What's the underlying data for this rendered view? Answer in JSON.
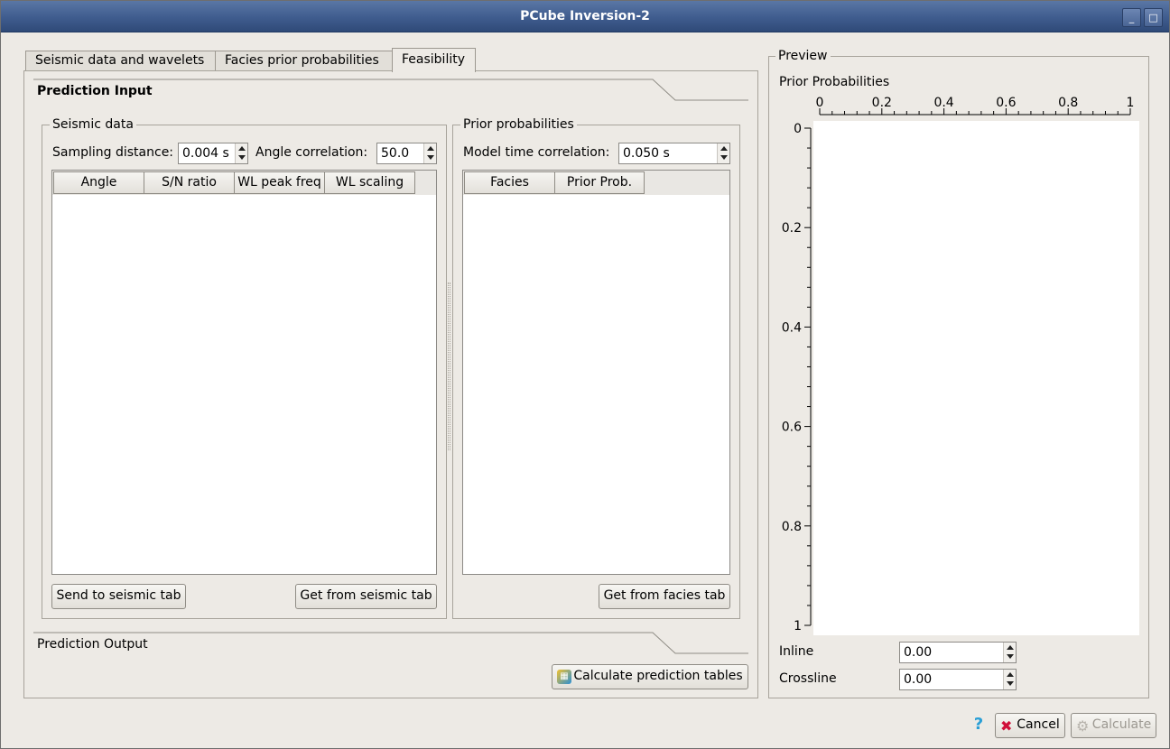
{
  "window": {
    "title": "PCube Inversion-2",
    "minimize_glyph": "_",
    "maximize_glyph": "□"
  },
  "tabs": [
    {
      "label": "Seismic data and wavelets",
      "active": false
    },
    {
      "label": "Facies prior probabilities",
      "active": false
    },
    {
      "label": "Feasibility",
      "active": true
    }
  ],
  "prediction_input": {
    "heading": "Prediction Input",
    "seismic": {
      "title": "Seismic data",
      "sampling_label": "Sampling distance:",
      "sampling_value": "0.004 s",
      "angle_label": "Angle correlation:",
      "angle_value": "50.0",
      "columns": [
        "Angle",
        "S/N ratio",
        "WL peak freq",
        "WL scaling"
      ],
      "send_button": "Send to seismic tab",
      "get_button": "Get from seismic tab"
    },
    "prior": {
      "title": "Prior probabilities",
      "model_time_label": "Model time correlation:",
      "model_time_value": "0.050 s",
      "columns": [
        "Facies",
        "Prior Prob."
      ],
      "get_button": "Get from facies tab"
    }
  },
  "prediction_output": {
    "heading": "Prediction Output",
    "calc_tables_button": "Calculate prediction tables",
    "calc_icon": "calculator-icon"
  },
  "preview": {
    "title": "Preview",
    "chart_title": "Prior Probabilities",
    "inline_label": "Inline",
    "inline_value": "0.00",
    "crossline_label": "Crossline",
    "crossline_value": "0.00"
  },
  "chart_data": {
    "type": "scatter",
    "title": "Prior Probabilities",
    "x_ticks": [
      "0",
      "0.2",
      "0.4",
      "0.6",
      "0.8",
      "1"
    ],
    "y_ticks": [
      "0",
      "0.2",
      "0.4",
      "0.6",
      "0.8",
      "1"
    ],
    "xlim": [
      0,
      1
    ],
    "ylim": [
      0,
      1
    ],
    "x_axis_position": "top",
    "y_inverted": true,
    "series": []
  },
  "footer": {
    "help_icon": "help-icon",
    "help_glyph": "?",
    "cancel_glyph": "✖",
    "calc_glyph": "⚙",
    "cancel_label": "Cancel",
    "calculate_label": "Calculate",
    "calculate_enabled": false
  },
  "colors": {
    "titlebar": "#3f5c8e",
    "background": "#edeae5",
    "cancel_icon": "#d0103a",
    "help_icon": "#2a9fd6"
  }
}
